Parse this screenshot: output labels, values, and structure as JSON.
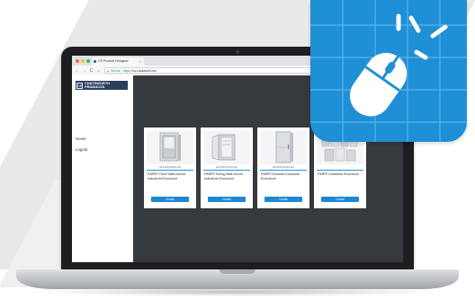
{
  "browser": {
    "tab_title": "CP Product Designer",
    "tab_close": "×",
    "nav_back": "←",
    "nav_forward": "→",
    "nav_reload": "C",
    "nav_home": "⌂",
    "secure_label": "Secure",
    "url_protocol": "https://",
    "url_rest": "hsi.cdaitasoft.com"
  },
  "logo": {
    "mark": "CP",
    "name": "CHATSWORTH PRODUCTS",
    "tagline": "Designed to the Customer"
  },
  "sidebar": {
    "items": [
      {
        "label": "Home"
      },
      {
        "label": "Logout"
      }
    ]
  },
  "products": [
    {
      "part_number": "AB-00000-000000-000",
      "title": "RMR® Fixed Wall-Mount Industrial Enclosure",
      "button": "Create"
    },
    {
      "part_number": "AB-00000-000000-000",
      "title": "RMR® Swing Wall-Mount Industrial Enclosure",
      "button": "Create"
    },
    {
      "part_number": "AB-00000-000000-000",
      "title": "RMR® Modular Industrial Enclosure",
      "button": "Create"
    },
    {
      "part_number": "",
      "title": "RMR® Industrial Enclosure",
      "button": "Create"
    }
  ],
  "colors": {
    "accent": "#1e88d2",
    "icon_bg": "#1f8fd6",
    "app_bg": "#36393d",
    "logo_bg": "#2c3e5c"
  },
  "icons": [
    "cursor-click-icon",
    "secure-lock-icon"
  ]
}
